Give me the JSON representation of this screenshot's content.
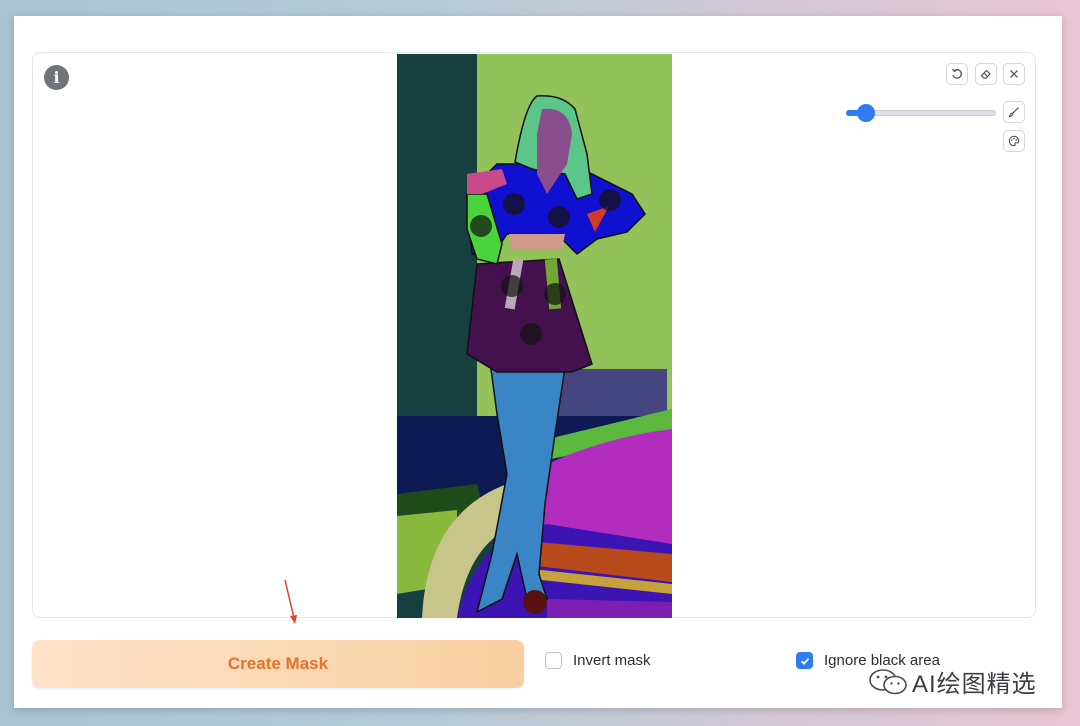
{
  "toolbar": {
    "undo_icon": "undo-icon",
    "eraser_icon": "eraser-icon",
    "close_icon": "close-icon",
    "brush_icon": "brush-icon",
    "palette_icon": "palette-icon"
  },
  "brush_size": {
    "value_fraction": 0.13
  },
  "colors": {
    "accent": "#2f7cf2",
    "button_text": "#e5722e",
    "button_bg": "#f9cfa1",
    "arrow": "#e0442b"
  },
  "actions": {
    "create_mask_label": "Create Mask",
    "invert_mask_label": "Invert mask",
    "invert_mask_checked": false,
    "ignore_black_label": "Ignore black area",
    "ignore_black_checked": true
  },
  "watermark": {
    "text": "AI绘图精选"
  }
}
